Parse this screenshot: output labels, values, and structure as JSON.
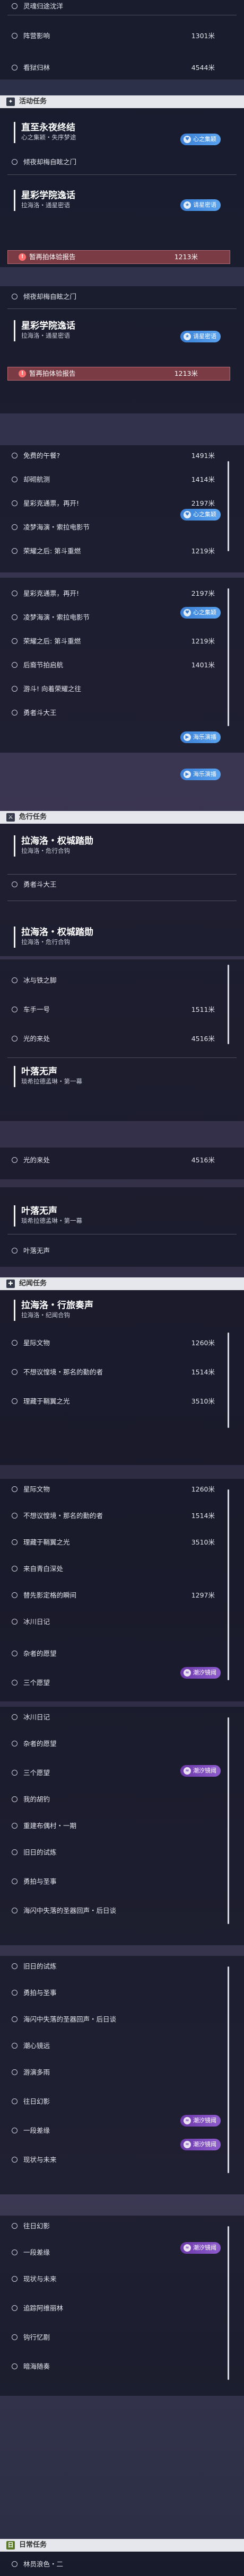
{
  "colors": {
    "header_bg": "#e6e7ec",
    "highlight": "#7a3b45",
    "badge_blue": "#3a7fd5",
    "badge_purple": "#6b3aa8"
  },
  "s1": {
    "i1": "灵魂归途沈洋",
    "i2": "阵营影响",
    "i2d": "1301米",
    "i3": "看狱归林",
    "i3d": "4544米"
  },
  "cat_activity": "活动任务",
  "q1": {
    "title": "直至永夜终结",
    "sub": "心之集颖・失序梦途",
    "badge": "心之集颖"
  },
  "q1i1": "倾夜却梅自眩之门",
  "q2": {
    "title": "星彩学院逸话",
    "sub": "拉海洛・通星密语",
    "badge_top": "请星密语",
    "hl": "暂再拍体验报告",
    "hl_dist": "1213米"
  },
  "q2i1": "倾夜却梅自眩之门",
  "q3": {
    "title": "星彩学院逸话",
    "sub": "拉海洛・通星密语",
    "badge_top": "请星密语",
    "hl": "暂再拍体验报告",
    "hl_dist": "1213米"
  },
  "s3": [
    {
      "t": "免费的午餐?",
      "d": "1491米"
    },
    {
      "t": "却砌航测",
      "d": "1414米"
    },
    {
      "t": "星彩克通票，再开!",
      "d": "2197米"
    },
    {
      "t": "凌梦海演・索拉电影节",
      "d": ""
    },
    {
      "t": "荣耀之后: 第斗重燃",
      "d": "1219米"
    }
  ],
  "badge_xinzhi": "心之集颖",
  "s4": [
    {
      "t": "星彩克通票，再开!",
      "d": "2197米"
    },
    {
      "t": "凌梦海演・索拉电影节",
      "d": ""
    },
    {
      "t": "荣耀之后: 第斗重燃",
      "d": "1219米"
    },
    {
      "t": "后裔节拍启航",
      "d": "1401米"
    },
    {
      "t": "游斗! 向着荣耀之往",
      "d": ""
    },
    {
      "t": "勇者斗大王",
      "d": ""
    }
  ],
  "badge_hailu": "海乐演播",
  "cat_hero": "危行任务",
  "s5i": "勇者斗大王",
  "q4": {
    "title": "拉海洛・权城踏勋",
    "sub": "拉海洛・危行合钩"
  },
  "q5": {
    "title": "拉海洛・权城踏勋",
    "sub": "拉海洛・危行合钩"
  },
  "s6": [
    {
      "t": "冰与铁之脚",
      "d": ""
    },
    {
      "t": "车手一号",
      "d": "1511米"
    },
    {
      "t": "光的来处",
      "d": "4516米"
    }
  ],
  "q6": {
    "title": "叶落无声",
    "sub": "琰希拉德孟琳・第一幕"
  },
  "s7i": "光的来处",
  "s7d": "4516米",
  "q7": {
    "title": "叶落无声",
    "sub": "琰希拉德孟琳・第一幕"
  },
  "s8i": "叶落无声",
  "cat_memory": "纪闻任务",
  "q8": {
    "title": "拉海洛・行旅奏声",
    "sub": "拉海洛・纪闻合钩"
  },
  "s9": [
    {
      "t": "星际文物",
      "d": "1260米"
    },
    {
      "t": "不想议惶境・那名的勤的者",
      "d": "1514米"
    },
    {
      "t": "理藏于鞘翼之光",
      "d": "3510米"
    }
  ],
  "s10": [
    {
      "t": "星际文物",
      "d": "1260米"
    },
    {
      "t": "不想议惶境・那名的勤的者",
      "d": "1514米"
    },
    {
      "t": "理藏于鞘翼之光",
      "d": "3510米"
    },
    {
      "t": "来自青白深处",
      "d": ""
    },
    {
      "t": "替先影定格的瞬间",
      "d": "1297米"
    },
    {
      "t": "冰川日记",
      "d": ""
    },
    {
      "t": "杂者的愿望",
      "d": ""
    },
    {
      "t": "三个愿望",
      "d": ""
    }
  ],
  "badge_chaoxi": "潮汐镜阈",
  "s11": [
    {
      "t": "冰川日记",
      "d": ""
    },
    {
      "t": "杂者的愿望",
      "d": ""
    },
    {
      "t": "三个愿望",
      "d": ""
    },
    {
      "t": "我的胡钓",
      "d": ""
    },
    {
      "t": "重建布偶村・一期",
      "d": ""
    },
    {
      "t": "旧日的试炼",
      "d": ""
    },
    {
      "t": "勇拍与圣事",
      "d": ""
    },
    {
      "t": "海闪中失落的圣器回声・后日谈",
      "d": ""
    }
  ],
  "s12": [
    {
      "t": "旧日的试炼",
      "d": ""
    },
    {
      "t": "勇拍与圣事",
      "d": ""
    },
    {
      "t": "海闪中失落的圣器回声・后日谈",
      "d": ""
    },
    {
      "t": "潮心镜远",
      "d": ""
    },
    {
      "t": "游演多雨",
      "d": ""
    },
    {
      "t": "往日幻影",
      "d": ""
    },
    {
      "t": "一段差缘",
      "d": ""
    },
    {
      "t": "现状与未来",
      "d": ""
    }
  ],
  "s13": [
    {
      "t": "往日幻影",
      "d": ""
    },
    {
      "t": "一段差缘",
      "d": ""
    },
    {
      "t": "现状与未来",
      "d": ""
    },
    {
      "t": "追踪阿维丽林",
      "d": ""
    },
    {
      "t": "钩行忆剧",
      "d": ""
    },
    {
      "t": "暗海随奏",
      "d": ""
    }
  ],
  "cat_daily": "日常任务",
  "s14i": "林员浪色・二"
}
